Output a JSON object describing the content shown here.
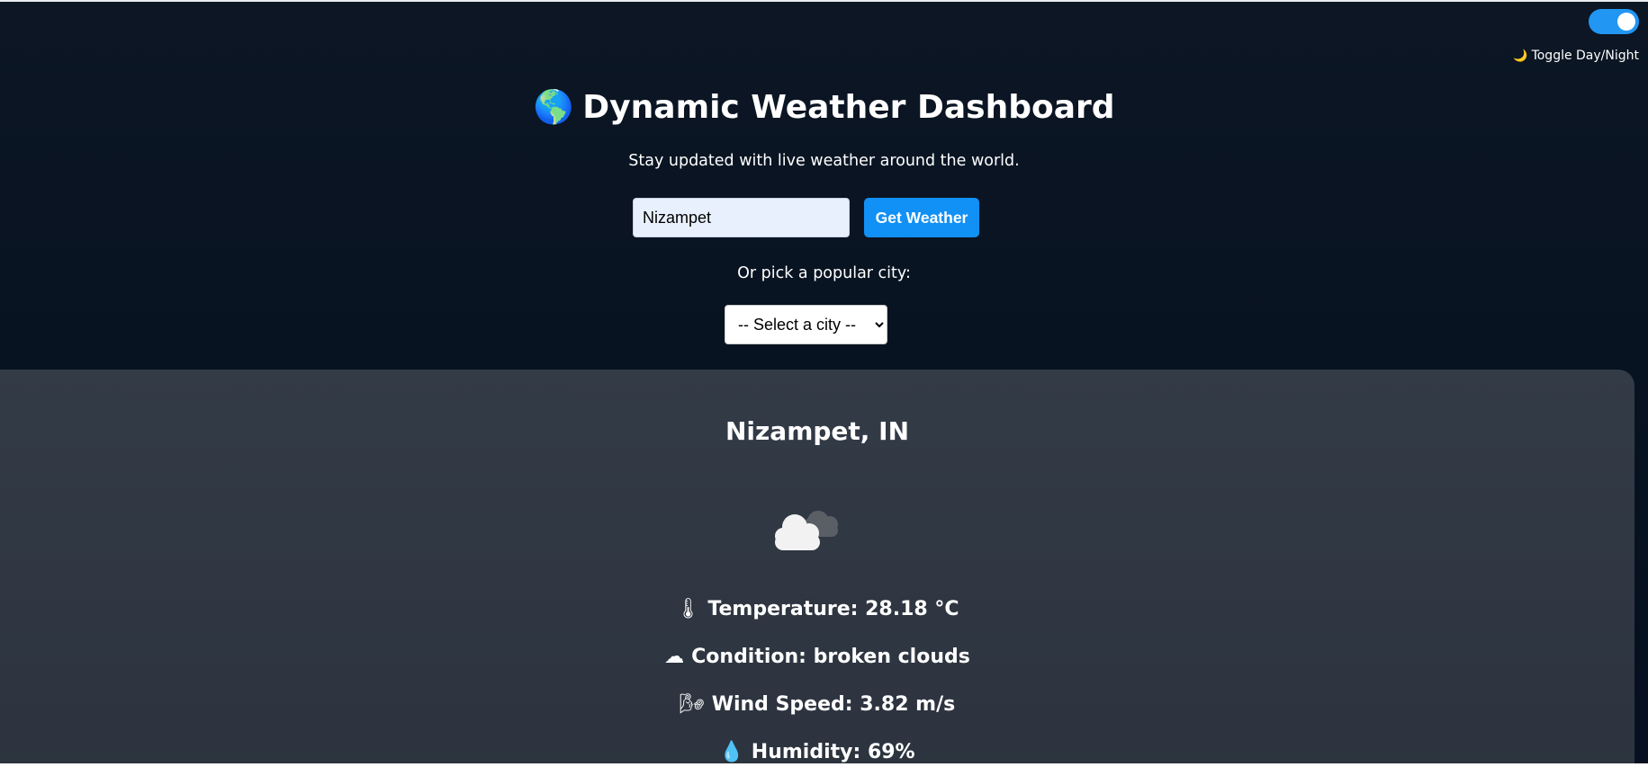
{
  "toggle": {
    "label": "Toggle Day/Night",
    "icon": "moon-icon",
    "checked": true
  },
  "header": {
    "title": "Dynamic Weather Dashboard",
    "title_icon": "globe-icon",
    "subtitle": "Stay updated with live weather around the world."
  },
  "search": {
    "value": "Nizampet",
    "button_label": "Get Weather"
  },
  "popular": {
    "label": "Or pick a popular city:",
    "select_value": "-- Select a city --"
  },
  "weather": {
    "location": "Nizampet, IN",
    "icon": "broken-clouds-icon",
    "temperature": "Temperature: 28.18 °C",
    "condition": "Condition: broken clouds",
    "wind": "Wind Speed: 3.82 m/s",
    "humidity": "Humidity: 69%"
  },
  "colors": {
    "accent": "#1190f5",
    "toggle_on": "#2196f3",
    "page_bg": "#0a1423",
    "card_bg": "#303844"
  }
}
